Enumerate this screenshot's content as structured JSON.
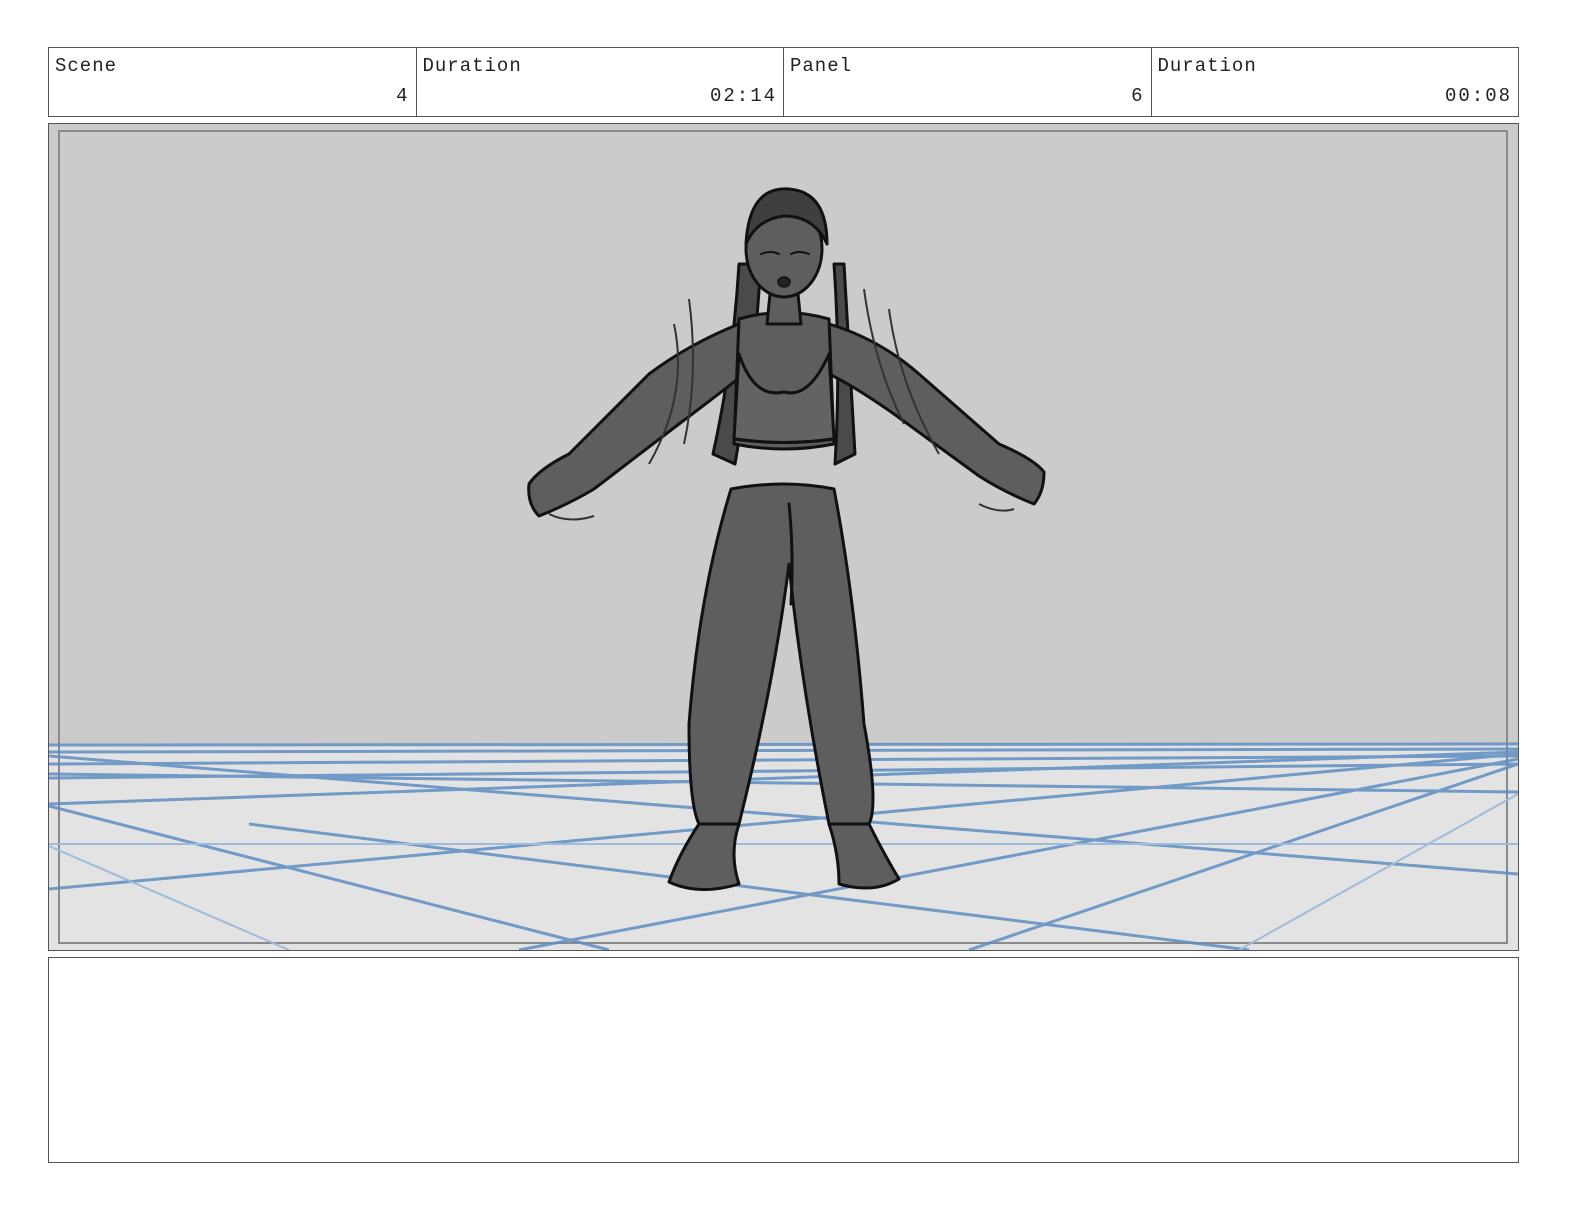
{
  "header": {
    "cells": [
      {
        "label": "Scene",
        "value": "4"
      },
      {
        "label": "Duration",
        "value": "02:14"
      },
      {
        "label": "Panel",
        "value": "6"
      },
      {
        "label": "Duration",
        "value": "00:08"
      }
    ]
  },
  "panel": {
    "image": {
      "subject": "storyboard sketch",
      "colors": {
        "wall": "#cbcbcb",
        "floor": "#e3e3e3",
        "grid_lines": "#5f8ec2",
        "figure": "#5e5e5e",
        "outline": "#111111"
      }
    }
  },
  "notes": {
    "text": ""
  }
}
